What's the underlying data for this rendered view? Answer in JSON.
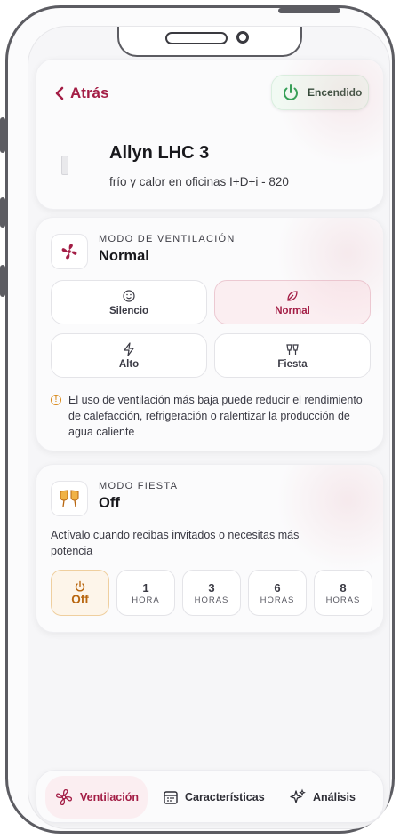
{
  "header": {
    "back_label": "Atrás",
    "power_label": "Encendido",
    "device_name": "Allyn LHC 3",
    "device_subtitle": "frío y calor en oficinas I+D+i - 820"
  },
  "ventilation": {
    "section_label": "MODO DE VENTILACIÓN",
    "current_mode": "Normal",
    "modes": [
      {
        "label": "Silencio",
        "icon": "baby-icon"
      },
      {
        "label": "Normal",
        "icon": "leaf-icon"
      },
      {
        "label": "Alto",
        "icon": "lightning-icon"
      },
      {
        "label": "Fiesta",
        "icon": "cheers-icon"
      }
    ],
    "selected_index": 1,
    "warning": "El uso de ventilación más baja puede reducir el rendimiento de calefacción, refrigeración o ralentizar la producción de agua caliente"
  },
  "party_mode": {
    "section_label": "MODO FIESTA",
    "current_value": "Off",
    "description": "Actívalo cuando recibas invitados o necesitas más potencia",
    "durations": [
      {
        "value": "Off",
        "unit": ""
      },
      {
        "value": "1",
        "unit": "HORA"
      },
      {
        "value": "3",
        "unit": "HORAS"
      },
      {
        "value": "6",
        "unit": "HORAS"
      },
      {
        "value": "8",
        "unit": "HORAS"
      }
    ],
    "selected_index": 0
  },
  "bottom_nav": {
    "items": [
      {
        "label": "Ventilación",
        "icon": "fan-icon"
      },
      {
        "label": "Características",
        "icon": "calendar-icon"
      },
      {
        "label": "Análisis",
        "icon": "sparkles-icon"
      }
    ],
    "active_index": 0
  },
  "colors": {
    "accent": "#a31d45",
    "power_green": "#2e9e52",
    "party_orange": "#b8660f",
    "warning": "#d98a1c"
  }
}
